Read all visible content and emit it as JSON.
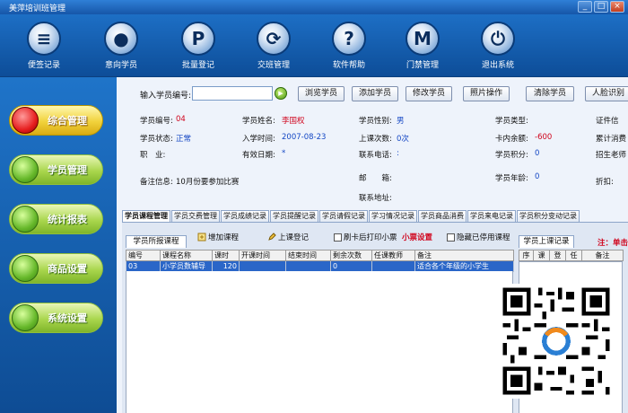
{
  "window": {
    "title": "美萍培训班管理",
    "controls": [
      "_",
      "□",
      "×"
    ]
  },
  "toolbar": [
    {
      "label": "便签记录",
      "icon": "notepad-icon",
      "glyph": "≡"
    },
    {
      "label": "意向学员",
      "icon": "user-icon",
      "glyph": "●"
    },
    {
      "label": "批量登记",
      "icon": "p-letter-icon",
      "glyph": "P"
    },
    {
      "label": "交班管理",
      "icon": "refresh-icon",
      "glyph": "⟳"
    },
    {
      "label": "软件帮助",
      "icon": "help-icon",
      "glyph": "?"
    },
    {
      "label": "门禁管理",
      "icon": "m-letter-icon",
      "glyph": "M"
    },
    {
      "label": "退出系统",
      "icon": "power-icon",
      "glyph": "⏻"
    }
  ],
  "sidebar": [
    {
      "label": "综合管理",
      "active": true
    },
    {
      "label": "学员管理",
      "active": false
    },
    {
      "label": "统计报表",
      "active": false
    },
    {
      "label": "商品设置",
      "active": false
    },
    {
      "label": "系统设置",
      "active": false
    }
  ],
  "search": {
    "label": "输入学员编号:",
    "value": "",
    "go": "▶",
    "buttons": [
      "浏览学员",
      "添加学员",
      "修改学员",
      "照片操作",
      "清除学员",
      "人脸识别"
    ]
  },
  "info": {
    "row1": {
      "id_label": "学员编号:",
      "id_value": "04",
      "name_label": "学员姓名:",
      "name_value": "李国权",
      "gender_label": "学员性别:",
      "gender_value": "男",
      "type_label": "学员类型:",
      "cert_label": "证件信"
    },
    "row2": {
      "status_label": "学员状态:",
      "status_value": "正常",
      "enroll_label": "入学时间:",
      "enroll_value": "2007-08-23",
      "times_label": "上课次数:",
      "times_value": "0次",
      "card_label": "卡内余额:",
      "card_value": "-600",
      "total_label": "累计消费"
    },
    "row3": {
      "job_label": "职　业:",
      "valid_label": "有效日期:",
      "valid_value": "*",
      "phone_label": "联系电话:",
      "phone_value": ":",
      "points_label": "学员积分:",
      "points_value": "0",
      "recruit_label": "招生老师"
    },
    "row4": {
      "note_label": "备注信息:",
      "note_value": "10月份要参加比赛",
      "mail_label": "邮　　箱:",
      "age_label": "学员年龄:",
      "age_value": "0",
      "discount_label": "折扣:"
    },
    "row5": {
      "addr_label": "联系地址:"
    }
  },
  "tabs": [
    "学员课程管理",
    "学员交费管理",
    "学员成绩记录",
    "学员提醒记录",
    "学员请假记录",
    "学习情况记录",
    "学员商品消费",
    "学员来电记录",
    "学员积分变动记录"
  ],
  "panel": {
    "subtab": "学员所报课程",
    "add_course": "增加课程",
    "checkin": "上课登记",
    "print_receipt": "刷卡后打印小票",
    "receipt_settings": "小票设置",
    "hide_disabled": "隐藏已停用课程",
    "columns": [
      "编号",
      "课程名称",
      "课时",
      "开课时间",
      "结束时间",
      "剩余次数",
      "任课教师",
      "备注"
    ],
    "rows": [
      [
        "03",
        "小学员数辅导",
        "120",
        "",
        "",
        "0",
        "",
        "适合各个年级的小学生"
      ]
    ]
  },
  "right": {
    "tab": "学员上课记录",
    "note": "注：单击",
    "columns": [
      "序",
      "课",
      "登",
      "任",
      "备注"
    ]
  },
  "colors": {
    "accent": "#1d6fc5",
    "selected_row": "#2a66c8",
    "red_text": "#d0021b",
    "blue_text": "#1447c4"
  }
}
